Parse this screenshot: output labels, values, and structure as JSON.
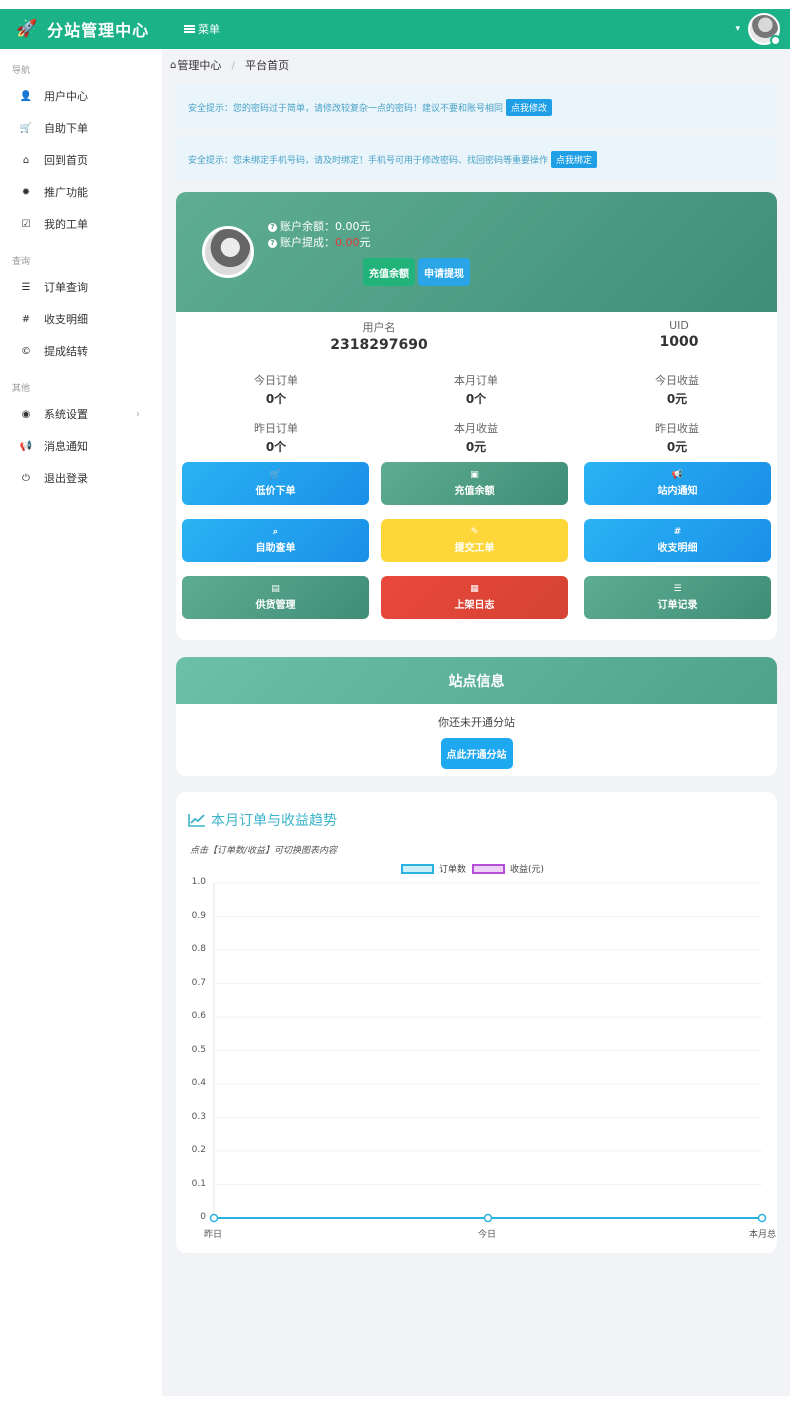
{
  "header": {
    "brand_title": "分站管理中心",
    "brand_icon": "rocket-icon",
    "menu_label": "菜单",
    "accent_color": "#1bb287"
  },
  "sidebar": {
    "sections": [
      {
        "title": "导航",
        "items": [
          {
            "label": "用户中心",
            "icon": "user-icon"
          },
          {
            "label": "自助下单",
            "icon": "cart-icon"
          },
          {
            "label": "回到首页",
            "icon": "home-icon"
          },
          {
            "label": "推广功能",
            "icon": "cog-icon"
          },
          {
            "label": "我的工单",
            "icon": "checkbox-icon"
          }
        ]
      },
      {
        "title": "查询",
        "items": [
          {
            "label": "订单查询",
            "icon": "list-icon"
          },
          {
            "label": "收支明细",
            "icon": "hash-icon"
          },
          {
            "label": "提成结转",
            "icon": "copyright-icon"
          }
        ]
      },
      {
        "title": "其他",
        "items": [
          {
            "label": "系统设置",
            "icon": "settings-icon"
          },
          {
            "label": "消息通知",
            "icon": "megaphone-icon"
          },
          {
            "label": "退出登录",
            "icon": "power-icon"
          }
        ]
      }
    ]
  },
  "breadcrumb": {
    "home": "管理中心",
    "current": "平台首页"
  },
  "alerts": [
    {
      "text": "安全提示：您的密码过于简单，请修改较复杂一点的密码！建议不要和账号相同",
      "button": "点我修改"
    },
    {
      "text": "安全提示：您未绑定手机号码，请及时绑定！手机号可用于修改密码、找回密码等重要操作",
      "button": "点我绑定"
    }
  ],
  "profile": {
    "balance_label": "账户余额：",
    "balance_value": "0.00元",
    "commission_label": "账户提成：",
    "commission_value": "0.00",
    "commission_unit": "元",
    "recharge_button": "充值余额",
    "withdraw_button": "申请提现",
    "username_label": "用户名",
    "username_value": "2318297690",
    "uid_label": "UID",
    "uid_value": "1000"
  },
  "stats": [
    {
      "label": "今日订单",
      "value": "0个"
    },
    {
      "label": "本月订单",
      "value": "0个"
    },
    {
      "label": "今日收益",
      "value": "0元"
    },
    {
      "label": "昨日订单",
      "value": "0个"
    },
    {
      "label": "本月收益",
      "value": "0元"
    },
    {
      "label": "昨日收益",
      "value": "0元"
    }
  ],
  "actions": [
    {
      "label": "低价下单",
      "icon": "cart-icon"
    },
    {
      "label": "充值余额",
      "icon": "money-icon"
    },
    {
      "label": "站内通知",
      "icon": "megaphone-icon"
    },
    {
      "label": "自助查单",
      "icon": "search-icon"
    },
    {
      "label": "提交工单",
      "icon": "ticket-icon"
    },
    {
      "label": "收支明细",
      "icon": "hash-icon"
    },
    {
      "label": "供货管理",
      "icon": "briefcase-icon"
    },
    {
      "label": "上架日志",
      "icon": "calendar-icon"
    },
    {
      "label": "订单记录",
      "icon": "list-icon"
    }
  ],
  "site_info": {
    "title": "站点信息",
    "message": "你还未开通分站",
    "button": "点此开通分站"
  },
  "chart_section": {
    "title": "本月订单与收益趋势",
    "hint": "点击【订单数/收益】可切换图表内容"
  },
  "chart_data": {
    "type": "line",
    "x": [
      "昨日",
      "今日",
      "本月总"
    ],
    "series": [
      {
        "name": "订单数",
        "values": [
          0,
          0,
          0
        ],
        "color": "#2ab3e0"
      },
      {
        "name": "收益(元)",
        "values": [
          0,
          0,
          0
        ],
        "color": "#b44fd6"
      }
    ],
    "ylim": [
      0,
      1.0
    ],
    "yticks": [
      "0",
      "0.1",
      "0.2",
      "0.3",
      "0.4",
      "0.5",
      "0.6",
      "0.7",
      "0.8",
      "0.9",
      "1.0"
    ],
    "legend": "top-center",
    "grid": true
  }
}
